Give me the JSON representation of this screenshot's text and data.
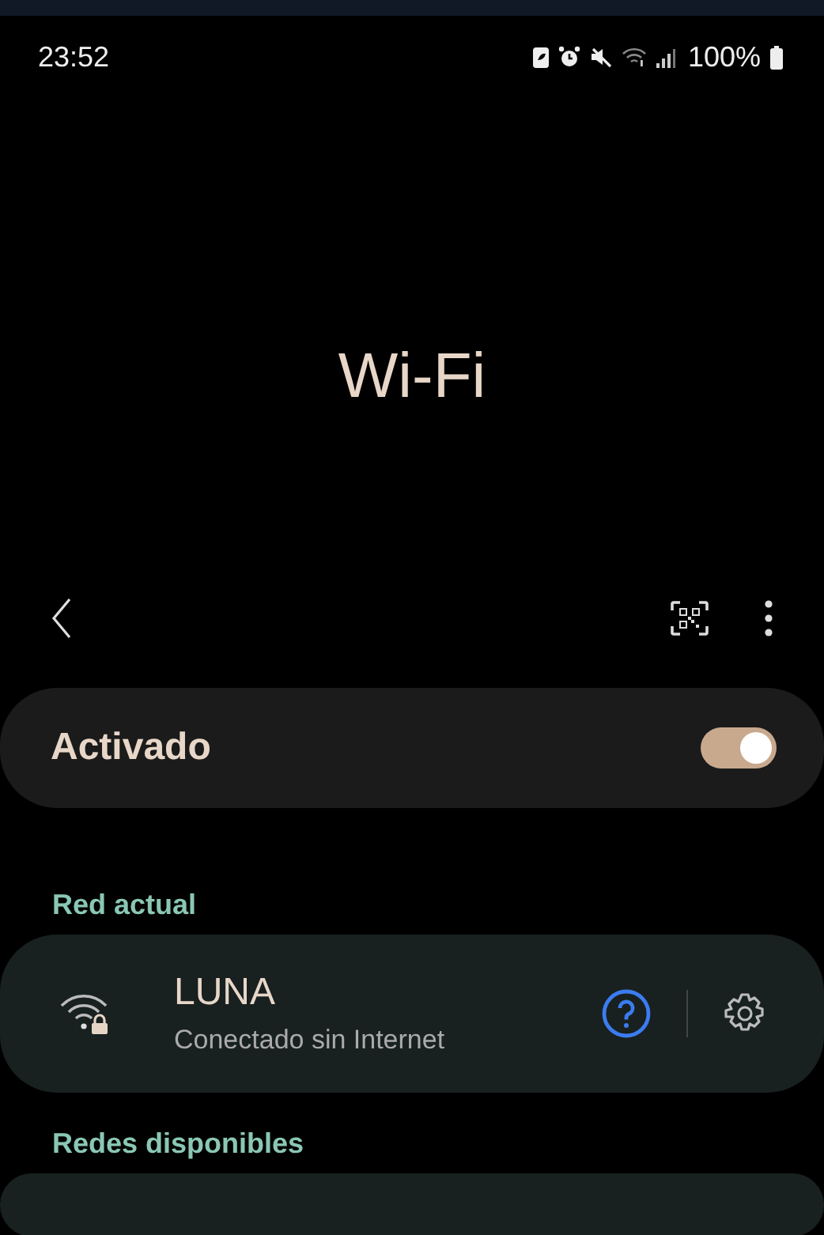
{
  "status_bar": {
    "time": "23:52",
    "battery": "100%"
  },
  "title": "Wi-Fi",
  "master_switch": {
    "label": "Activado",
    "on": true
  },
  "current_network": {
    "heading": "Red actual",
    "name": "LUNA",
    "status": "Conectado sin Internet"
  },
  "available_networks": {
    "heading": "Redes disponibles"
  }
}
